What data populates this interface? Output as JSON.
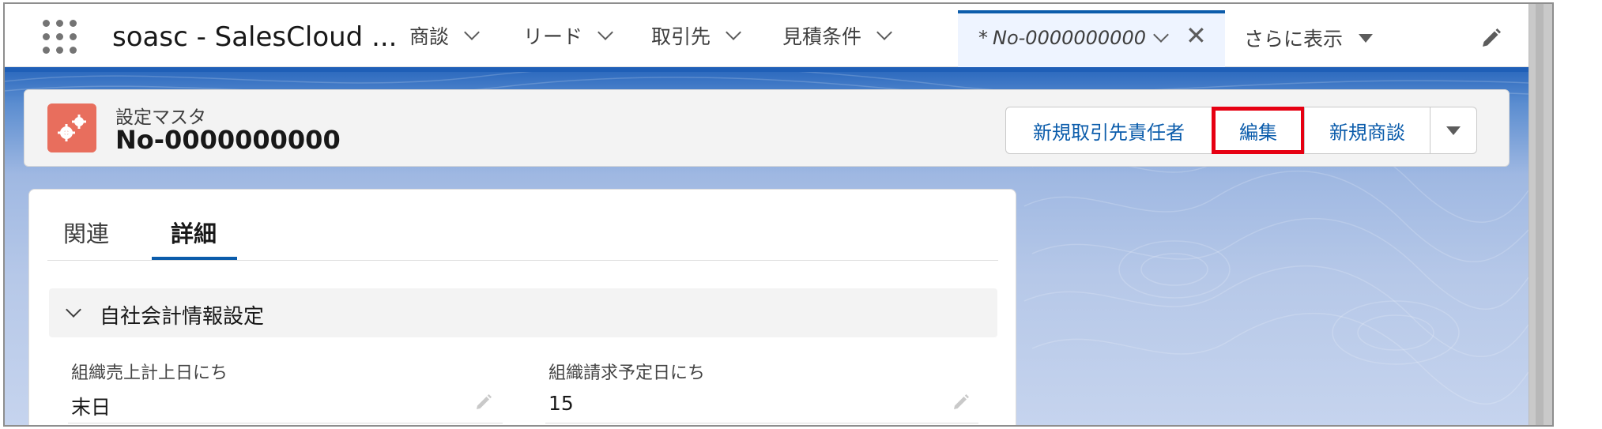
{
  "nav": {
    "app_name": "soasc - SalesCloud ...",
    "items": [
      {
        "label": "商談"
      },
      {
        "label": "リード"
      },
      {
        "label": "取引先"
      },
      {
        "label": "見積条件"
      }
    ],
    "active_tab": {
      "prefix": "*",
      "label": "No-0000000000"
    },
    "more_label": "さらに表示"
  },
  "record": {
    "object_label": "設定マスタ",
    "title": "No-0000000000",
    "actions": [
      "新規取引先責任者",
      "編集",
      "新規商談"
    ],
    "highlighted_action": "編集"
  },
  "detail": {
    "tabs": [
      "関連",
      "詳細"
    ],
    "active_tab": "詳細",
    "section_title": "自社会計情報設定",
    "fields": [
      {
        "label": "組織売上計上日にち",
        "value": "末日"
      },
      {
        "label": "組織請求予定日にち",
        "value": "15"
      }
    ]
  },
  "colors": {
    "accent": "#0b5cab",
    "object_icon": "#e86e5d",
    "highlight_box": "#e60012"
  }
}
